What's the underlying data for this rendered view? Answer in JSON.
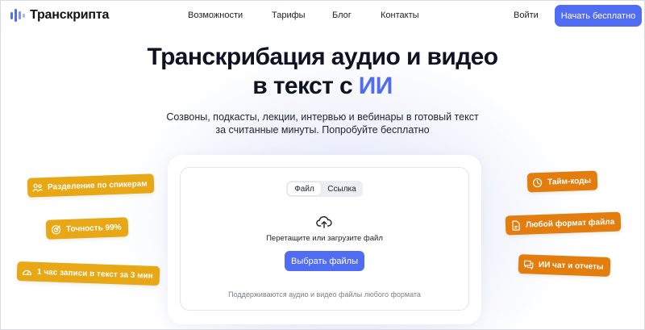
{
  "header": {
    "logo_text": "Транскрипта",
    "nav": [
      "Возможности",
      "Тарифы",
      "Блог",
      "Контакты"
    ],
    "login": "Войти",
    "cta": "Начать бесплатно"
  },
  "hero": {
    "title_line1": "Транскрибация аудио и видео",
    "title_line2_prefix": "в текст с ",
    "title_line2_accent": "ИИ",
    "subtitle_line1": "Созвоны, подкасты, лекции, интервью и вебинары в готовый текст",
    "subtitle_line2": "за считанные минуты. Попробуйте бесплатно"
  },
  "uploader": {
    "tabs": [
      "Файл",
      "Ссылка"
    ],
    "active_tab": "Файл",
    "icon": "cloud-upload-icon",
    "drop_text": "Перетащите или загрузите файл",
    "choose_button": "Выбрать файлы",
    "support_text": "Поддерживаются аудио и видео файлы любого формата"
  },
  "features_left": [
    {
      "label": "Разделение по спикерам",
      "icon": "speakers-icon"
    },
    {
      "label": "Точность 99%",
      "icon": "target-icon"
    },
    {
      "label": "1 час записи в текст за 3 мин",
      "icon": "speedometer-icon"
    }
  ],
  "features_right": [
    {
      "label": "Тайм-коды",
      "icon": "clock-icon"
    },
    {
      "label": "Любой формат файла",
      "icon": "file-icon"
    },
    {
      "label": "ИИ чат и отчеты",
      "icon": "chat-icon"
    }
  ],
  "colors": {
    "accent": "#4f6cf3",
    "chip_yellow": "#e8a714",
    "chip_orange": "#e37d0d",
    "text": "#0f1222"
  }
}
